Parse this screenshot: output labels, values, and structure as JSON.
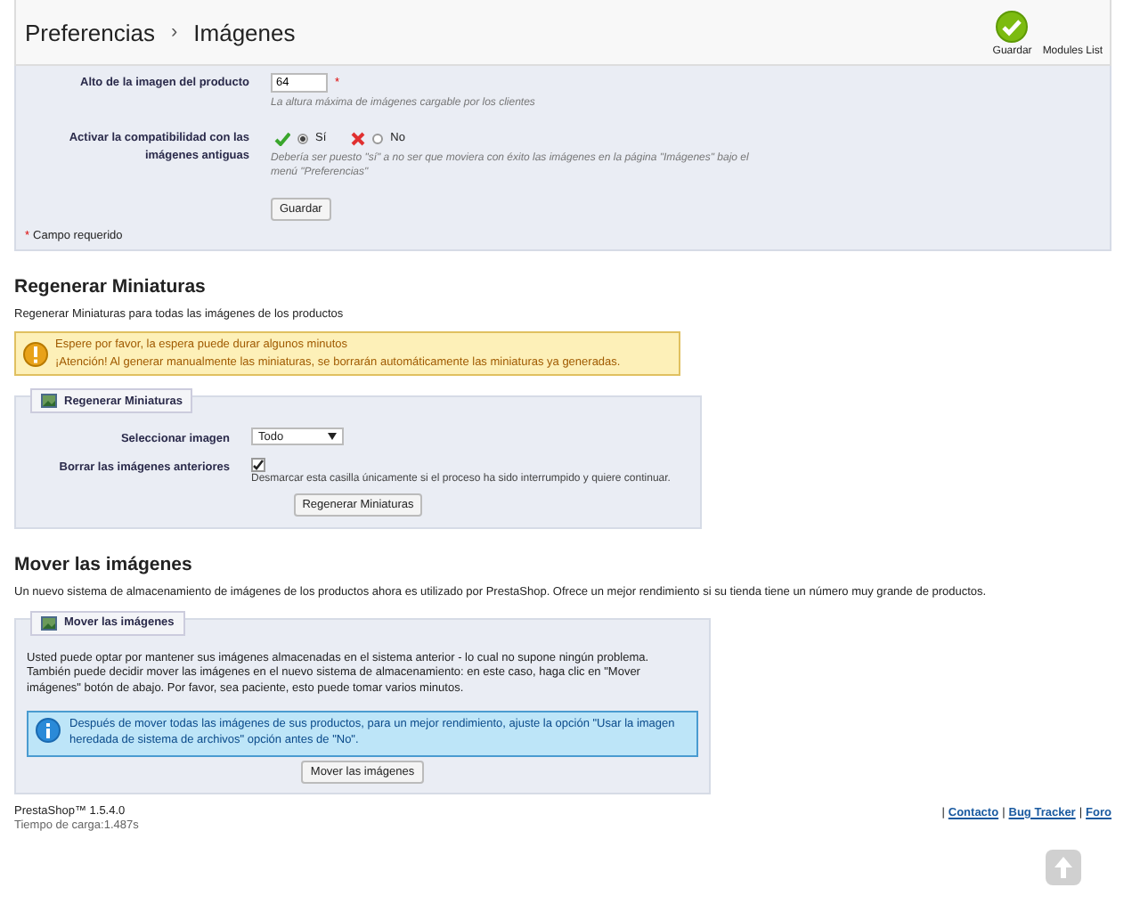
{
  "header": {
    "breadcrumb": [
      "Preferencias",
      "Imágenes"
    ],
    "separator": "›",
    "toolbar": [
      {
        "kind": "save",
        "label": "Guardar"
      },
      {
        "kind": "link",
        "label": "Modules List"
      }
    ]
  },
  "settings_form": {
    "rows": [
      {
        "kind": "text",
        "label": "Alto de la imagen del producto",
        "value": "64",
        "required": true,
        "help": "La altura máxima de imágenes cargable por los clientes"
      },
      {
        "kind": "yesno",
        "label": "Activar la compatibilidad con las imágenes antiguas",
        "options": [
          {
            "label": "Sí",
            "selected": true
          },
          {
            "label": "No",
            "selected": false
          }
        ],
        "help": "Debería ser puesto \"sí\" a no ser que moviera con éxito las imágenes en la página \"Imágenes\" bajo el menú \"Preferencias\""
      }
    ],
    "button": "Guardar",
    "required_note": "Campo requerido",
    "required_mark": "*"
  },
  "regenerate": {
    "title": "Regenerar Miniaturas",
    "description": "Regenerar Miniaturas para todas las imágenes de los productos",
    "warning": [
      "Espere por favor, la espera puede durar algunos minutos",
      "¡Atención! Al generar manualmente las miniaturas, se borrarán automáticamente las miniaturas ya generadas."
    ],
    "legend": "Regenerar Miniaturas",
    "select": {
      "label": "Seleccionar imagen",
      "value": "Todo"
    },
    "checkbox": {
      "label": "Borrar las imágenes anteriores",
      "checked": true,
      "help": "Desmarcar esta casilla únicamente si el proceso ha sido interrumpido y quiere continuar."
    },
    "button": "Regenerar Miniaturas"
  },
  "move": {
    "title": "Mover las imágenes",
    "description": "Un nuevo sistema de almacenamiento de imágenes de los productos ahora es utilizado por PrestaShop. Ofrece un mejor rendimiento si su tienda tiene un número muy grande de productos.",
    "legend": "Mover las imágenes",
    "text": "Usted puede optar por mantener sus imágenes almacenadas en el sistema anterior - lo cual no supone ningún problema. También puede decidir mover las imágenes en el nuevo sistema de almacenamiento: en este caso, haga clic en \"Mover imágenes\" botón de abajo. Por favor, sea paciente, esto puede tomar varios minutos.",
    "info": "Después de mover todas las imágenes de sus productos, para un mejor rendimiento, ajuste la opción \"Usar la imagen heredada de sistema de archivos\" opción antes de \"No\".",
    "button": "Mover las imágenes"
  },
  "footer": {
    "version": "PrestaShop™ 1.5.4.0",
    "load_time": "Tiempo de carga:1.487s",
    "links": [
      "Contacto",
      "Bug Tracker",
      "Foro"
    ],
    "divider": "|"
  }
}
